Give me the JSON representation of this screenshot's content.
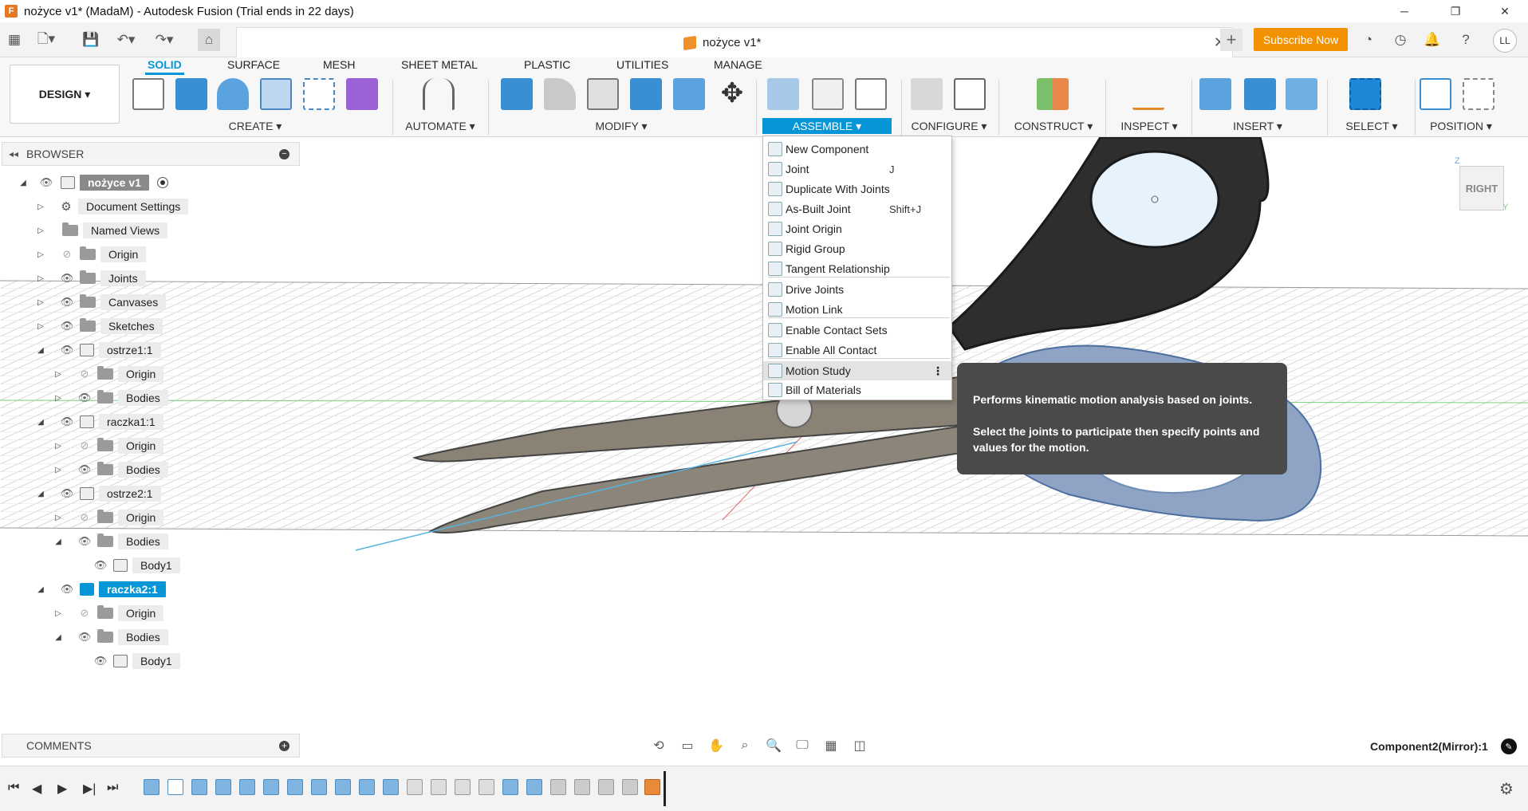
{
  "window": {
    "title": "nożyce v1* (MadaM) - Autodesk Fusion (Trial ends in 22 days)",
    "minimize": "─",
    "restore": "❐",
    "close": "✕"
  },
  "appbar": {
    "document_tab": "nożyce v1*",
    "close_tab": "✕",
    "new_tab": "+",
    "subscribe": "Subscribe Now",
    "avatar": "LL"
  },
  "ribbon": {
    "workspace": "DESIGN ▾",
    "tabs": [
      "SOLID",
      "SURFACE",
      "MESH",
      "SHEET METAL",
      "PLASTIC",
      "UTILITIES",
      "MANAGE"
    ],
    "groups": {
      "create": "CREATE ▾",
      "automate": "AUTOMATE ▾",
      "modify": "MODIFY ▾",
      "assemble": "ASSEMBLE ▾",
      "configure": "CONFIGURE ▾",
      "construct": "CONSTRUCT ▾",
      "inspect": "INSPECT ▾",
      "insert": "INSERT ▾",
      "select": "SELECT ▾",
      "position": "POSITION ▾"
    }
  },
  "browser": {
    "title": "BROWSER",
    "root": "nożyce v1",
    "items": {
      "document_settings": "Document Settings",
      "named_views": "Named Views",
      "origin": "Origin",
      "joints": "Joints",
      "canvases": "Canvases",
      "sketches": "Sketches",
      "ostrze1": "ostrze1:1",
      "bodies": "Bodies",
      "raczka1": "raczka1:1",
      "ostrze2": "ostrze2:1",
      "body1": "Body1",
      "raczka2": "raczka2:1"
    }
  },
  "assemble_menu": {
    "items": [
      {
        "label": "New Component",
        "shortcut": ""
      },
      {
        "label": "Joint",
        "shortcut": "J"
      },
      {
        "label": "Duplicate With Joints",
        "shortcut": ""
      },
      {
        "label": "As-Built Joint",
        "shortcut": "Shift+J"
      },
      {
        "label": "Joint Origin",
        "shortcut": ""
      },
      {
        "label": "Rigid Group",
        "shortcut": ""
      },
      {
        "label": "Tangent Relationship",
        "shortcut": ""
      },
      {
        "label": "Drive Joints",
        "shortcut": ""
      },
      {
        "label": "Motion Link",
        "shortcut": ""
      },
      {
        "label": "Enable Contact Sets",
        "shortcut": ""
      },
      {
        "label": "Enable All Contact",
        "shortcut": ""
      },
      {
        "label": "Motion Study",
        "shortcut": ""
      },
      {
        "label": "Bill of Materials",
        "shortcut": ""
      }
    ]
  },
  "tooltip": {
    "line1": "Performs kinematic motion analysis based on joints.",
    "line2": "Select the joints to participate then specify points and values for the motion."
  },
  "viewcube": {
    "face": "RIGHT",
    "axis_z": "Z",
    "axis_y": "Y"
  },
  "comments": {
    "title": "COMMENTS"
  },
  "status": {
    "component": "Component2(Mirror):1"
  }
}
